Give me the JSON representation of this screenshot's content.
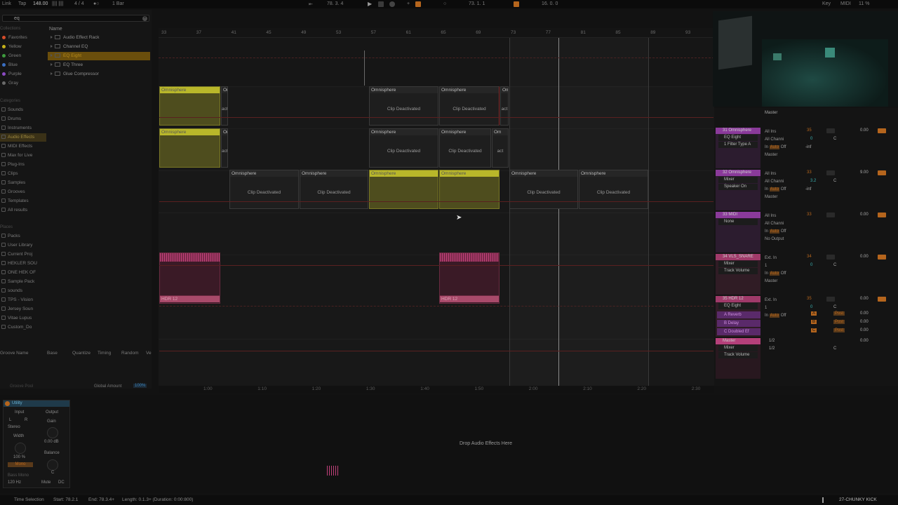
{
  "transport": {
    "link": "Link",
    "tap": "Tap",
    "tempo": "148.00",
    "tempo_nudge": "|||| ||||",
    "signature": "4 / 4",
    "quantize": "1 Bar",
    "arrangement_position": "78. 3. 4",
    "loop_start": "73. 1. 1",
    "loop_length": "16. 0. 0",
    "key_label": "Key",
    "midi_label": "MIDI",
    "cpu": "11 %"
  },
  "browser": {
    "search_value": "eq",
    "collections_header": "Collections",
    "collections": [
      {
        "label": "Favorites",
        "color": "#d64c2a"
      },
      {
        "label": "Yellow",
        "color": "#c7b21a"
      },
      {
        "label": "Green",
        "color": "#3e9b3e"
      },
      {
        "label": "Blue",
        "color": "#3a6fc2"
      },
      {
        "label": "Purple",
        "color": "#8b4ac2"
      },
      {
        "label": "Gray",
        "color": "#6a6a6a"
      }
    ],
    "categories_header": "Categories",
    "categories": [
      "Sounds",
      "Drums",
      "Instruments",
      "Audio Effects",
      "MIDI Effects",
      "Max for Live",
      "Plug-Ins",
      "Clips",
      "Samples",
      "Grooves",
      "Templates",
      "All results"
    ],
    "places_header": "Places",
    "places": [
      "Packs",
      "User Library",
      "Current Proj",
      "HEKLER SOU",
      "ONE HEK OF",
      "Sample Pack",
      "sounds",
      "TPS - Vision",
      "Jersey Soun",
      "Vitae Lupus",
      "Custom_Do"
    ],
    "name_column": "Name",
    "files": [
      "Audio Effect Rack",
      "Channel EQ",
      "EQ Eight",
      "EQ Three",
      "Glue Compressor"
    ],
    "selected_file_index": 2,
    "selected_category_index": 3
  },
  "groove_pool": {
    "columns": [
      "Groove Name",
      "Base",
      "Quantize",
      "Timing",
      "Random",
      "Ve"
    ],
    "title": "Groove Pool",
    "global_amount_label": "Global Amount",
    "global_amount": "100%"
  },
  "ruler": [
    "33",
    "37",
    "41",
    "45",
    "49",
    "53",
    "57",
    "61",
    "65",
    "69",
    "73",
    "77",
    "81",
    "85",
    "89",
    "93"
  ],
  "timeline": [
    "1:00",
    "1:10",
    "1:20",
    "1:30",
    "1:40",
    "1:50",
    "2:00",
    "2:10",
    "2:20",
    "2:30"
  ],
  "clips": {
    "omni_label": "Omnisphere",
    "om_short": "Om",
    "deactivated": "Clip Deactivated",
    "act_short": "act",
    "hdr_label": "HDR 12"
  },
  "mixer": {
    "master_label": "Master",
    "tracks": [
      {
        "name": "31 Omnisphere",
        "device": "EQ Eight",
        "device2": "1 Filter Type A",
        "input": "All Ins",
        "channel": "All Channi",
        "output": "Master",
        "vol": "35",
        "pan": "0",
        "pan_label": "C",
        "db": "0.00",
        "inf": "-inf",
        "color": "#8a3a9a"
      },
      {
        "name": "32 Omnisphere",
        "device": "Mixer",
        "device2": "Speaker On",
        "input": "All Ins",
        "channel": "All Channi",
        "output": "Master",
        "vol": "33",
        "pan": "3.2",
        "pan_label": "C",
        "db": "9.00",
        "inf": "-inf",
        "color": "#8a3a9a"
      },
      {
        "name": "33 MIDI",
        "device": "None",
        "input": "All Ins",
        "channel": "All Channi",
        "output": "No Output",
        "vol": "33",
        "db": "0.00",
        "color": "#8a3a9a"
      },
      {
        "name": "34 VLS_SNARE",
        "device": "Mixer",
        "device2": "Track Volume",
        "input": "Ext. In",
        "channel": "1",
        "output": "Master",
        "vol": "34",
        "pan": "0",
        "pan_label": "C",
        "db": "0.00",
        "color": "#a03a6a"
      },
      {
        "name": "35 HDR 12",
        "device": "EQ Eight",
        "input": "Ext. In",
        "channel": "1",
        "vol": "35",
        "pan": "0",
        "pan_label": "C",
        "db": "0.00",
        "color": "#a03a6a"
      }
    ],
    "returns": [
      {
        "name": "A Reverb",
        "letter": "A",
        "send": "Post",
        "db": "0.00"
      },
      {
        "name": "B Delay",
        "letter": "B",
        "send": "Post",
        "db": "0.00"
      },
      {
        "name": "C Doubled Ef",
        "letter": "C",
        "send": "Post",
        "db": "0.00"
      }
    ],
    "master": {
      "name": "Master",
      "device": "Mixer",
      "device2": "Track Volume",
      "cue": "1/2",
      "out": "1/2",
      "db": "0.00",
      "pan_label": "C"
    },
    "monitor_in": "In",
    "monitor_auto": "Auto",
    "monitor_off": "Off"
  },
  "device": {
    "name": "Utility",
    "input_label": "Input",
    "output_label": "Output",
    "left_btn": "L",
    "right_btn": "R",
    "stereo": "Stereo",
    "gain_label": "Gain",
    "gain_value": "0.00 dB",
    "width_label": "Width",
    "width_value": "100 %",
    "mono_btn": "Mono",
    "bass_mono": "Bass Mono",
    "balance_label": "Balance",
    "balance_value": "C",
    "bass_freq": "120 Hz",
    "mute_label": "Mute",
    "dc_label": "DC",
    "drop_hint": "Drop Audio Effects Here"
  },
  "status": {
    "selection": "Time Selection",
    "start": "Start: 78.2.1",
    "end": "End: 78.3.4+",
    "length": "Length: 0.1.3+ (Duration: 0:00:800)",
    "track": "27-CHUNKY KICK"
  }
}
